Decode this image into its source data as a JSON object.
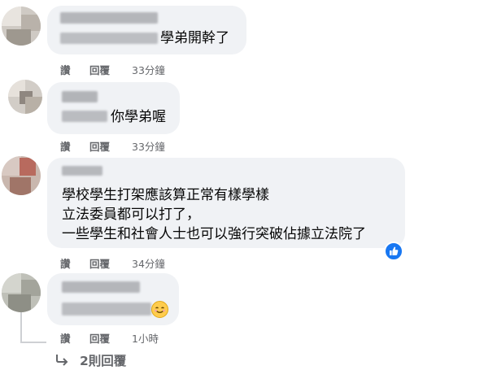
{
  "comments": [
    {
      "text_lines": [
        "學弟開幹了"
      ],
      "actions": {
        "like": "讚",
        "reply": "回覆",
        "time": "33分鐘"
      }
    },
    {
      "text_lines": [
        "你學弟喔"
      ],
      "actions": {
        "like": "讚",
        "reply": "回覆",
        "time": "33分鐘"
      }
    },
    {
      "text_lines": [
        "學校學生打架應該算正常有樣學樣",
        "立法委員都可以打了，",
        "一些學生和社會人士也可以強行突破佔據立法院了"
      ],
      "reaction_icon": "like-icon",
      "actions": {
        "like": "讚",
        "reply": "回覆",
        "time": "34分鐘"
      }
    },
    {
      "text_lines": [],
      "emoji": "smiling-emoji-icon",
      "actions": {
        "like": "讚",
        "reply": "回覆",
        "time": "1小時"
      }
    }
  ],
  "more_replies": {
    "icon": "reply-arrow-icon",
    "label": "2則回覆"
  },
  "colors": {
    "bubble": "#f0f2f5",
    "meta": "#65676b",
    "like_blue": "#1877f2"
  }
}
